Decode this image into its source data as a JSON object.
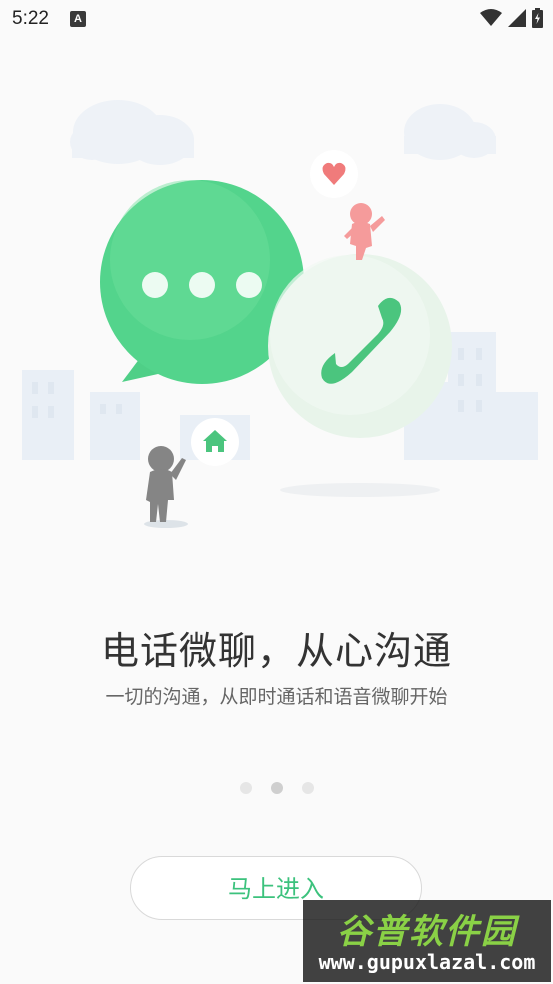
{
  "status_bar": {
    "time": "5:22",
    "notification_badge": "A"
  },
  "onboarding": {
    "title": "电话微聊，从心沟通",
    "subtitle": "一切的沟通，从即时通话和语音微聊开始",
    "page_count": 3,
    "current_page": 2
  },
  "enter_button": {
    "label": "马上进入"
  },
  "watermark": {
    "title": "谷普软件园",
    "url": "www.gupuxlazal.com"
  },
  "colors": {
    "accent": "#3cc27d",
    "chat_bubble": "#53d48c",
    "phone_circle": "#e9f5ec",
    "heart": "#f07b7b"
  },
  "icons": [
    "wifi-icon",
    "signal-icon",
    "battery-icon",
    "chat-bubble-icon",
    "phone-icon",
    "heart-icon",
    "home-icon"
  ]
}
